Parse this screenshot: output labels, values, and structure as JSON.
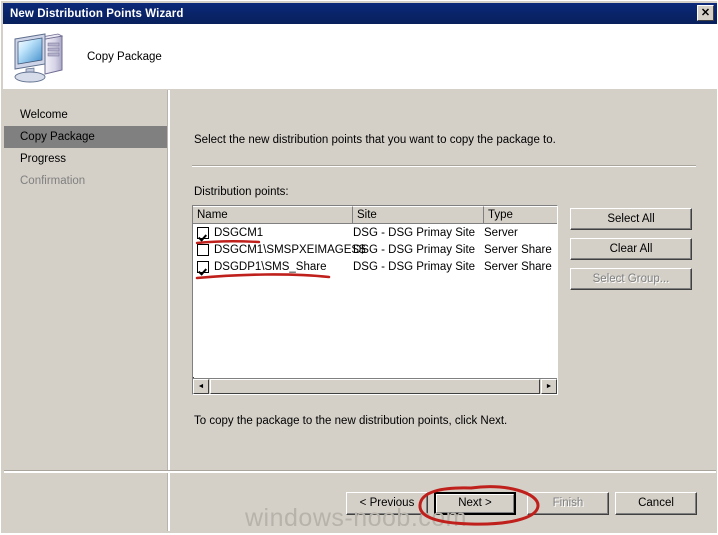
{
  "window": {
    "title": "New Distribution Points Wizard",
    "close_label": "✕"
  },
  "header": {
    "icon": "computer-icon",
    "page_title": "Copy Package"
  },
  "sidebar": {
    "items": [
      {
        "label": "Welcome",
        "state": "normal"
      },
      {
        "label": "Copy Package",
        "state": "selected"
      },
      {
        "label": "Progress",
        "state": "normal"
      },
      {
        "label": "Confirmation",
        "state": "disabled"
      }
    ]
  },
  "main": {
    "instruction": "Select the new distribution points that you want to copy the package to.",
    "list_label": "Distribution points:",
    "footnote": "To copy the package to the new distribution points, click Next.",
    "columns": [
      "Name",
      "Site",
      "Type"
    ],
    "rows": [
      {
        "checked": true,
        "name": "DSGCM1",
        "site": "DSG - DSG Primay Site",
        "type": "Server"
      },
      {
        "checked": false,
        "name": "DSGCM1\\SMSPXEIMAGES$",
        "site": "DSG - DSG Primay Site",
        "type": "Server Share"
      },
      {
        "checked": true,
        "name": "DSGDP1\\SMS_Share",
        "site": "DSG - DSG Primay Site",
        "type": "Server Share"
      }
    ],
    "scrollbar": {
      "left_arrow": "◄",
      "right_arrow": "►"
    }
  },
  "side_buttons": [
    {
      "label": "Select All",
      "enabled": true
    },
    {
      "label": "Clear All",
      "enabled": true
    },
    {
      "label": "Select Group...",
      "enabled": false
    }
  ],
  "nav_buttons": [
    {
      "label": "< Previous",
      "enabled": true,
      "default": false
    },
    {
      "label": "Next >",
      "enabled": true,
      "default": true
    },
    {
      "label": "Finish",
      "enabled": false,
      "default": false
    },
    {
      "label": "Cancel",
      "enabled": true,
      "default": false
    }
  ],
  "watermark": {
    "text": "windows-noob.com"
  },
  "annotations": {
    "color": "#c0201c",
    "marks": [
      "underline-dsgcm1",
      "underline-dsgdp1-sms-share",
      "ellipse-next-button"
    ]
  },
  "colors": {
    "titlebar": "#0a246a",
    "face": "#d4d0c8",
    "selection": "#808080",
    "annotation_red": "#c0201c",
    "watermark_gray": "#b7b3ab"
  }
}
